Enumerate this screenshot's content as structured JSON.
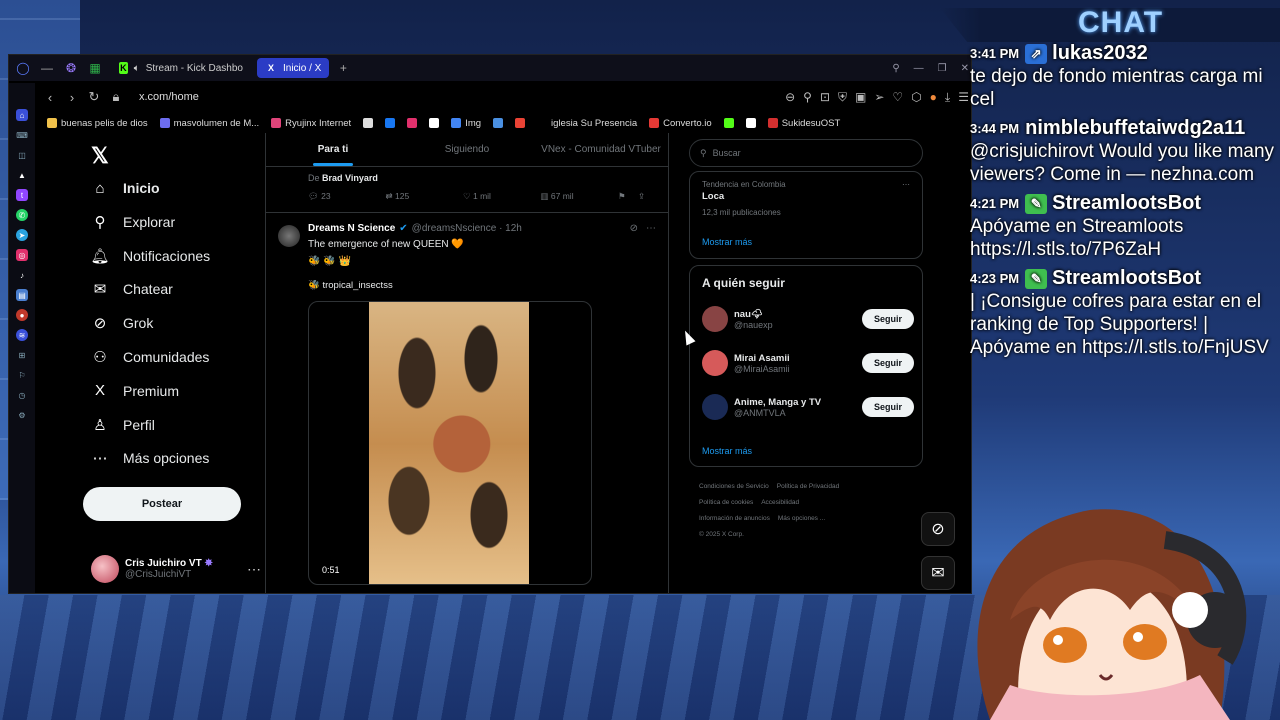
{
  "browser": {
    "tabs": [
      {
        "label": "Stream - Kick Dashbo",
        "icon": "kick-icon",
        "active": false
      },
      {
        "label": "Inicio / X",
        "icon": "x-icon",
        "active": true
      }
    ],
    "url": "x.com/home",
    "bookmarks": [
      {
        "label": "buenas pelis de dios",
        "color": "#f0c14b"
      },
      {
        "label": "masvolumen de M...",
        "color": "#6d6df0"
      },
      {
        "label": "Ryujinx Internet",
        "color": "#e0447a"
      },
      {
        "label": "",
        "color": "#dddddd"
      },
      {
        "label": "",
        "color": "#1877f2"
      },
      {
        "label": "",
        "color": "#e1306c"
      },
      {
        "label": "",
        "color": "#ffffff"
      },
      {
        "label": "Img",
        "color": "#4285f4"
      },
      {
        "label": "",
        "color": "#4a90e2"
      },
      {
        "label": "",
        "color": "#ea4335"
      },
      {
        "label": "iglesia Su Presencia",
        "color": "#000000"
      },
      {
        "label": "Converto.io",
        "color": "#e53935"
      },
      {
        "label": "",
        "color": "#53fc18"
      },
      {
        "label": "",
        "color": "#ffffff"
      },
      {
        "label": "SukidesuOST",
        "color": "#d32f2f"
      }
    ]
  },
  "x": {
    "nav": [
      {
        "label": "Inicio",
        "icon": "home-icon",
        "glyph": "⌂"
      },
      {
        "label": "Explorar",
        "icon": "search-icon",
        "glyph": "⚲"
      },
      {
        "label": "Notificaciones",
        "icon": "bell-icon",
        "glyph": "🔔︎"
      },
      {
        "label": "Chatear",
        "icon": "mail-icon",
        "glyph": "✉"
      },
      {
        "label": "Grok",
        "icon": "grok-icon",
        "glyph": "⊘"
      },
      {
        "label": "Comunidades",
        "icon": "people-icon",
        "glyph": "⚇"
      },
      {
        "label": "Premium",
        "icon": "x-premium-icon",
        "glyph": "X"
      },
      {
        "label": "Perfil",
        "icon": "person-icon",
        "glyph": "♙"
      },
      {
        "label": "Más opciones",
        "icon": "more-circle-icon",
        "glyph": "⋯"
      }
    ],
    "post_label": "Postear",
    "profile": {
      "name": "Cris Juichiro VT",
      "handle": "@CrisJuichiVT"
    },
    "timeline_tabs": [
      "Para ti",
      "Siguiendo",
      "VNex - Comunidad VTuber"
    ],
    "prev_tweet": {
      "by_prefix": "De",
      "by_name": "Brad Vinyard",
      "replies": "23",
      "reposts": "125",
      "likes": "1 mil",
      "views": "67 mil"
    },
    "tweet": {
      "name": "Dreams N Science",
      "handle": "@dreamsNscience · 12h",
      "text": "The emergence of new QUEEN 🧡",
      "emojis": "🐝 🐝 👑",
      "sub": "🐝 tropical_insectss",
      "duration": "0:51"
    },
    "search_placeholder": "Buscar",
    "trend": {
      "context": "Tendencia en Colombia",
      "title": "Loca",
      "count": "12,3 mil publicaciones",
      "more": "Mostrar más"
    },
    "who_to_follow": {
      "title": "A quién seguir",
      "users": [
        {
          "name": "nau🌩",
          "handle": "@nauexp",
          "button": "Seguir",
          "color": "#884444"
        },
        {
          "name": "Mirai Asamii",
          "handle": "@MiraiAsamii",
          "button": "Seguir",
          "color": "#d65a5a"
        },
        {
          "name": "Anime, Manga y TV",
          "handle": "@ANMTVLA",
          "button": "Seguir",
          "color": "#1a2a55"
        }
      ],
      "more": "Mostrar más"
    },
    "footer": [
      "Condiciones de Servicio",
      "Política de Privacidad",
      "Política de cookies",
      "Accesibilidad",
      "Información de anuncios",
      "Más opciones ...",
      "© 2025 X Corp."
    ]
  },
  "chat": {
    "title": "CHAT",
    "messages": [
      {
        "time": "3:41 PM",
        "user": "lukas2032",
        "badge": "kick-badge",
        "badge_color": "#2a6fd6",
        "text": "te dejo de fondo mientras carga mi cel"
      },
      {
        "time": "3:44 PM",
        "user": "nimblebuffetaiwdg2a11",
        "badge": "",
        "badge_color": "",
        "text": "@crisjuichirovt Would you like many viewers? Come in — nezhna.com"
      },
      {
        "time": "4:21 PM",
        "user": "StreamlootsBot",
        "badge": "bot-badge",
        "badge_color": "#3fbf4f",
        "text": "Apóyame en Streamloots https://l.stls.to/7P6ZaH"
      },
      {
        "time": "4:23 PM",
        "user": "StreamlootsBot",
        "badge": "bot-badge",
        "badge_color": "#3fbf4f",
        "text": "| ¡Consigue cofres para estar en el ranking de Top Supporters! | Apóyame en https://l.stls.to/FnjUSV"
      }
    ]
  }
}
